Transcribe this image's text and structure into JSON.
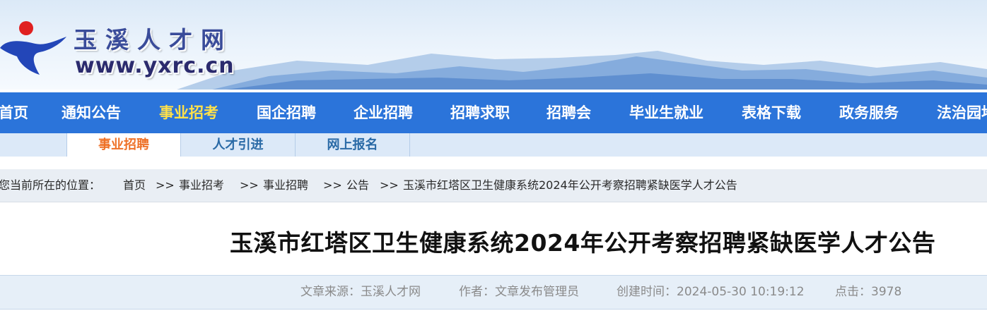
{
  "header": {
    "site_name": "玉溪人才网",
    "site_url": "www.yxrc.cn",
    "logo_icon": "yxrc-logo-icon",
    "brand_colors": {
      "red": "#e02020",
      "blue": "#2346b8"
    }
  },
  "nav": {
    "items": [
      "首页",
      "通知公告",
      "事业招考",
      "国企招聘",
      "企业招聘",
      "招聘求职",
      "招聘会",
      "毕业生就业",
      "表格下载",
      "政务服务",
      "法治园地"
    ],
    "active": "事业招考",
    "bg_color": "#2b74da",
    "active_color": "#ffe14a"
  },
  "subnav": {
    "tabs": [
      "事业招聘",
      "人才引进",
      "网上报名"
    ],
    "active": "事业招聘",
    "active_color": "#ee7127"
  },
  "breadcrumb": {
    "prefix": "您当前所在的位置：",
    "separator": ">>",
    "items": [
      "首页",
      "事业招考",
      "事业招聘",
      "公告",
      "玉溪市红塔区卫生健康系统2024年公开考察招聘紧缺医学人才公告"
    ]
  },
  "article": {
    "title": "玉溪市红塔区卫生健康系统2024年公开考察招聘紧缺医学人才公告",
    "source": "文章来源：玉溪人才网",
    "author": "作者：文章发布管理员",
    "created": "创建时间：2024-05-30 10:19:12",
    "clicks": "点击：3978"
  }
}
